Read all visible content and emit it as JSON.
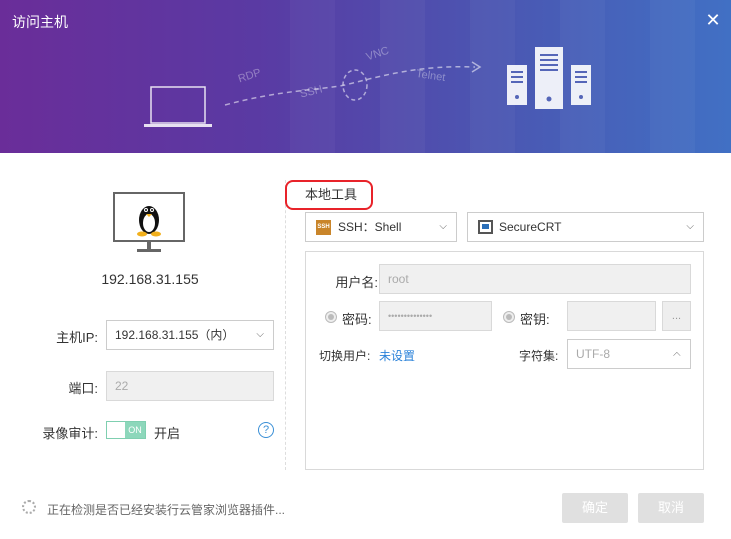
{
  "window": {
    "title": "访问主机",
    "close_glyph": "✕"
  },
  "banner": {
    "protocols": [
      "RDP",
      "SSH",
      "VNC",
      "Telnet"
    ]
  },
  "host": {
    "ip": "192.168.31.155",
    "host_ip_label": "主机IP:",
    "host_ip_value": "192.168.31.155（内）",
    "port_label": "端口:",
    "port_value": "22",
    "record_label": "录像审计:",
    "record_toggle_text": "ON",
    "record_state": "开启",
    "help_glyph": "?"
  },
  "local_tool": {
    "section_title": "本地工具",
    "protocol_badge": "SSH",
    "protocol_select": "SSH：Shell",
    "client_select": "SecureCRT",
    "username_label": "用户名:",
    "username_value": "root",
    "password_label": "密码:",
    "password_value": "••••••••••••••",
    "key_label": "密钥:",
    "key_button": "...",
    "switch_user_label": "切换用户:",
    "switch_user_value": "未设置",
    "charset_label": "字符集:",
    "charset_value": "UTF-8"
  },
  "footer": {
    "status": "正在检测是否已经安装行云管家浏览器插件...",
    "confirm": "确定",
    "cancel": "取消"
  },
  "colors": {
    "banner_start": "#6a2d99",
    "banner_end": "#4170c4",
    "highlight": "#e8232a",
    "link": "#2b82d9",
    "toggle": "#8dd7bb"
  }
}
